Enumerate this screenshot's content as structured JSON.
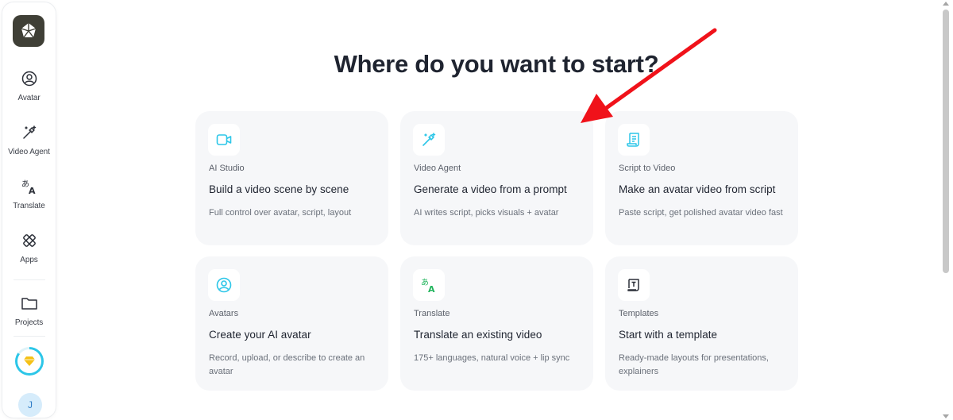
{
  "page": {
    "title": "Where do you want to start?"
  },
  "sidebar": {
    "items": [
      {
        "label": "Avatar",
        "icon": "avatar-icon"
      },
      {
        "label": "Video Agent",
        "icon": "magic-wand-icon"
      },
      {
        "label": "Translate",
        "icon": "translate-icon"
      },
      {
        "label": "Apps",
        "icon": "apps-icon"
      },
      {
        "label": "Projects",
        "icon": "folder-icon"
      }
    ],
    "user_initial": "J"
  },
  "cards": [
    {
      "kicker": "AI Studio",
      "title": "Build a video scene by scene",
      "desc": "Full control over avatar, script, layout",
      "icon": "video-camera-icon"
    },
    {
      "kicker": "Video Agent",
      "title": "Generate a video from a prompt",
      "desc": "AI writes script, picks visuals + avatar",
      "icon": "magic-wand-icon"
    },
    {
      "kicker": "Script to Video",
      "title": "Make an avatar video from script",
      "desc": "Paste script, get polished avatar video fast",
      "icon": "script-icon"
    },
    {
      "kicker": "Avatars",
      "title": "Create your AI avatar",
      "desc": "Record, upload, or describe to create an avatar",
      "icon": "avatar-icon"
    },
    {
      "kicker": "Translate",
      "title": "Translate an existing video",
      "desc": "175+ languages, natural voice + lip sync",
      "icon": "translate-icon"
    },
    {
      "kicker": "Templates",
      "title": "Start with a template",
      "desc": "Ready-made layouts for presentations, explainers",
      "icon": "template-icon"
    }
  ],
  "colors": {
    "accent": "#2cc6e8",
    "card_bg": "#f6f7f9",
    "arrow": "#f0121a",
    "translate_green": "#21b45c"
  }
}
